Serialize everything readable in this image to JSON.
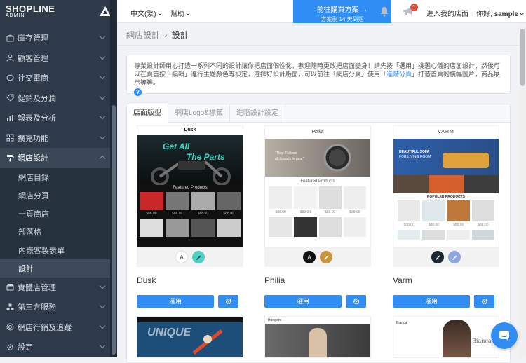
{
  "brand": {
    "name": "SHOPLINE",
    "sub": "ADMIN"
  },
  "sidebar": {
    "items": [
      {
        "label": "庫存管理"
      },
      {
        "label": "顧客管理"
      },
      {
        "label": "社交電商"
      },
      {
        "label": "促銷及分潤"
      },
      {
        "label": "報表及分析"
      },
      {
        "label": "擴充功能"
      },
      {
        "label": "網店設計"
      },
      {
        "label": "實體店管理"
      },
      {
        "label": "第三方服務"
      },
      {
        "label": "網店行銷及追蹤"
      },
      {
        "label": "設定"
      }
    ],
    "subitems": [
      {
        "label": "網店目錄"
      },
      {
        "label": "網店分頁"
      },
      {
        "label": "一頁商店"
      },
      {
        "label": "部落格"
      },
      {
        "label": "內嵌客製表單"
      },
      {
        "label": "設計"
      }
    ]
  },
  "topbar": {
    "lang": "中文(繁)",
    "help": "幫助",
    "upgrade_title": "前往購買方案 →",
    "upgrade_sub": "方案剩 14 天到期",
    "badge": "1",
    "enter_store": "進入我的店面",
    "hello_prefix": "你好, ",
    "hello_name": "sample"
  },
  "breadcrumb": {
    "parent": "網店設計",
    "sep": "›",
    "current": "設計"
  },
  "info": {
    "text1": "專業設計師用心打造一系列不同的設計讓你把店面個性化，歡迎隨時更改把店面變身！請先按「選用」挑選心儀的店面設計，然後可以在頁首按「編輯」進行主題顏色等設定，選擇好設計版面，可以前往「網店分頁」使用「",
    "link": "進階分頁",
    "text2": "」打造首頁的橫幅圖片，商品展示等等。",
    "q": "?"
  },
  "tabs": [
    {
      "label": "店面版型"
    },
    {
      "label": "網店Logo&標籤"
    },
    {
      "label": "進階設計設定"
    }
  ],
  "themes": [
    {
      "name": "Dusk",
      "apply": "選用",
      "hero": "Get All",
      "hero2": "The Parts",
      "header": "Dusk",
      "section": "Featured Products",
      "price1": "$88.00",
      "price2": "$88.00",
      "price3": "$88.00",
      "price4": "$88.00"
    },
    {
      "name": "Philia",
      "apply": "選用",
      "header": "Philia",
      "banner1": "\"Time Fellows",
      "banner2": "all threads in gear\"",
      "section": "Featured Products",
      "price1": "$88.00",
      "price2": "$88.00",
      "price3": "$88.00",
      "price4": "$88.00"
    },
    {
      "name": "Varm",
      "apply": "選用",
      "header": "VARM",
      "banner1": "BEAUTIFUL SOFA",
      "banner2": "FOR LIVING ROOM",
      "section": "POPULAR PRODUCTS",
      "price1": "$88.00",
      "price2": "$88.00",
      "price3": "$88.00",
      "price4": "$88.00"
    }
  ],
  "row2": [
    {
      "label": "UNIQUE"
    },
    {
      "label": "Hangers"
    },
    {
      "label": "Bianca"
    }
  ],
  "colors": {
    "accent": "#2f8df4",
    "sidebar": "#2e3a4a",
    "swatch_teal": "#4fd1c5",
    "swatch_gold": "#c8963e",
    "swatch_blue": "#8ca7e0"
  }
}
